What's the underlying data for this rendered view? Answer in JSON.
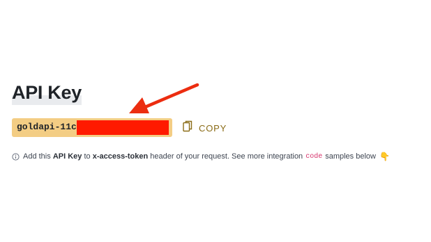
{
  "header": {
    "title": "API Key"
  },
  "api_key": {
    "value_visible": "goldapi-11c",
    "redacted": true
  },
  "copy": {
    "label": "COPY",
    "icon": "copy-icon"
  },
  "info": {
    "icon": "info-icon",
    "text_1": "Add this",
    "api_key_label": "API Key",
    "text_2": "to",
    "header_name": "x-access-token",
    "text_3": "header of your request. See more integration",
    "code_word": "code",
    "text_4": "samples below",
    "emoji": "👇"
  },
  "colors": {
    "key_bg": "#f3cd84",
    "redaction": "#ff1a00",
    "copy_text": "#8a6b16",
    "arrow": "#ec2d10",
    "code_text": "#d6336c"
  }
}
